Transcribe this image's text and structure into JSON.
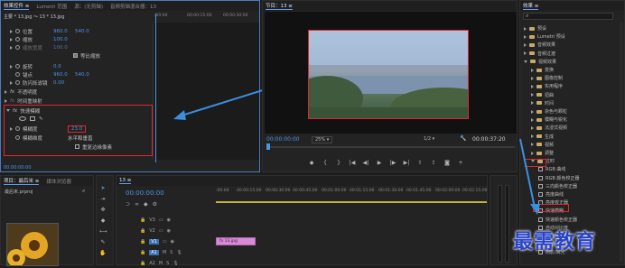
{
  "effect_controls": {
    "tabs": [
      "效果控件 ≡",
      "Lumetri 范围",
      "源：(无剪辑)",
      "音频剪辑混合器：13"
    ],
    "clip_header": "主要 * 13.jpg ～ 13 * 13.jpg",
    "ruler": [
      ":00:00",
      "00:00:15:00",
      "00:00:30:00"
    ],
    "rows": [
      {
        "label": "位置",
        "v1": "960.0",
        "v2": "540.0"
      },
      {
        "label": "缩放",
        "v1": "100.0"
      },
      {
        "label": "缩放宽度",
        "v1": "100.0"
      },
      {
        "label": "等比缩放"
      },
      {
        "label": "旋转",
        "v1": "0.0"
      },
      {
        "label": "锚点",
        "v1": "960.0",
        "v2": "540.0"
      },
      {
        "label": "防闪烁滤镜",
        "v1": "0.00"
      },
      {
        "label": "不透明度"
      },
      {
        "label": "时间重映射"
      },
      {
        "label": "快速模糊"
      },
      {
        "label": "模糊度",
        "v1": "23.0"
      },
      {
        "label": "模糊维度",
        "v1": "水平和垂直"
      },
      {
        "label": "重复边缘像素"
      }
    ],
    "time": "00:00:00:00"
  },
  "program": {
    "title": "节目：13 ≡",
    "timecode": "00:00:00:00",
    "fit": "25%",
    "quality": "1/2",
    "duration": "00:00:37:20"
  },
  "project": {
    "tabs": [
      "项目：最后米 ≡",
      "媒体浏览器"
    ],
    "file": "最后米.prproj"
  },
  "timeline": {
    "tab": "13 ≡",
    "timecode": "00:00:00:00",
    "ruler": [
      ":00:00",
      "00:00:15:00",
      "00:00:30:00",
      "00:00:45:00",
      "00:01:00:00",
      "00:01:15:00",
      "00:01:30:00",
      "00:01:45:00",
      "00:02:00:00",
      "00:02:15:00"
    ],
    "tracks": [
      "V3",
      "V2",
      "V1",
      "A1",
      "A2",
      "A3"
    ],
    "clip_label": "fx 13.jpg"
  },
  "effects": {
    "title": "效果 ≡",
    "items": [
      {
        "label": "预设",
        "depth": 0,
        "type": "folder"
      },
      {
        "label": "Lumetri 预设",
        "depth": 0,
        "type": "folder"
      },
      {
        "label": "音频效果",
        "depth": 0,
        "type": "folder"
      },
      {
        "label": "音频过渡",
        "depth": 0,
        "type": "folder"
      },
      {
        "label": "视频效果",
        "depth": 0,
        "type": "folder",
        "open": true
      },
      {
        "label": "变换",
        "depth": 1,
        "type": "folder"
      },
      {
        "label": "图像控制",
        "depth": 1,
        "type": "folder"
      },
      {
        "label": "实用程序",
        "depth": 1,
        "type": "folder"
      },
      {
        "label": "扭曲",
        "depth": 1,
        "type": "folder"
      },
      {
        "label": "时间",
        "depth": 1,
        "type": "folder"
      },
      {
        "label": "杂色与颗粒",
        "depth": 1,
        "type": "folder"
      },
      {
        "label": "模糊与锐化",
        "depth": 1,
        "type": "folder"
      },
      {
        "label": "沉浸式视频",
        "depth": 1,
        "type": "folder"
      },
      {
        "label": "生成",
        "depth": 1,
        "type": "folder"
      },
      {
        "label": "视频",
        "depth": 1,
        "type": "folder"
      },
      {
        "label": "调整",
        "depth": 1,
        "type": "folder"
      },
      {
        "label": "过时",
        "depth": 1,
        "type": "folder",
        "open": true
      },
      {
        "label": "RGB 曲线",
        "depth": 2,
        "type": "fx"
      },
      {
        "label": "RGB 颜色校正器",
        "depth": 2,
        "type": "fx"
      },
      {
        "label": "三向颜色校正器",
        "depth": 2,
        "type": "fx"
      },
      {
        "label": "亮度曲线",
        "depth": 2,
        "type": "fx"
      },
      {
        "label": "亮度校正器",
        "depth": 2,
        "type": "fx"
      },
      {
        "label": "快速模糊",
        "depth": 2,
        "type": "fx"
      },
      {
        "label": "快速颜色校正器",
        "depth": 2,
        "type": "fx"
      },
      {
        "label": "自动对比度",
        "depth": 2,
        "type": "fx"
      },
      {
        "label": "自动色阶",
        "depth": 2,
        "type": "fx"
      },
      {
        "label": "自动颜色",
        "depth": 2,
        "type": "fx"
      },
      {
        "label": "阴影/高光",
        "depth": 2,
        "type": "fx"
      }
    ]
  },
  "watermark": "最需教育",
  "colors": {
    "accent": "#4b93e6",
    "highlight": "#e0262e",
    "arrow": "#3b8fe0"
  }
}
